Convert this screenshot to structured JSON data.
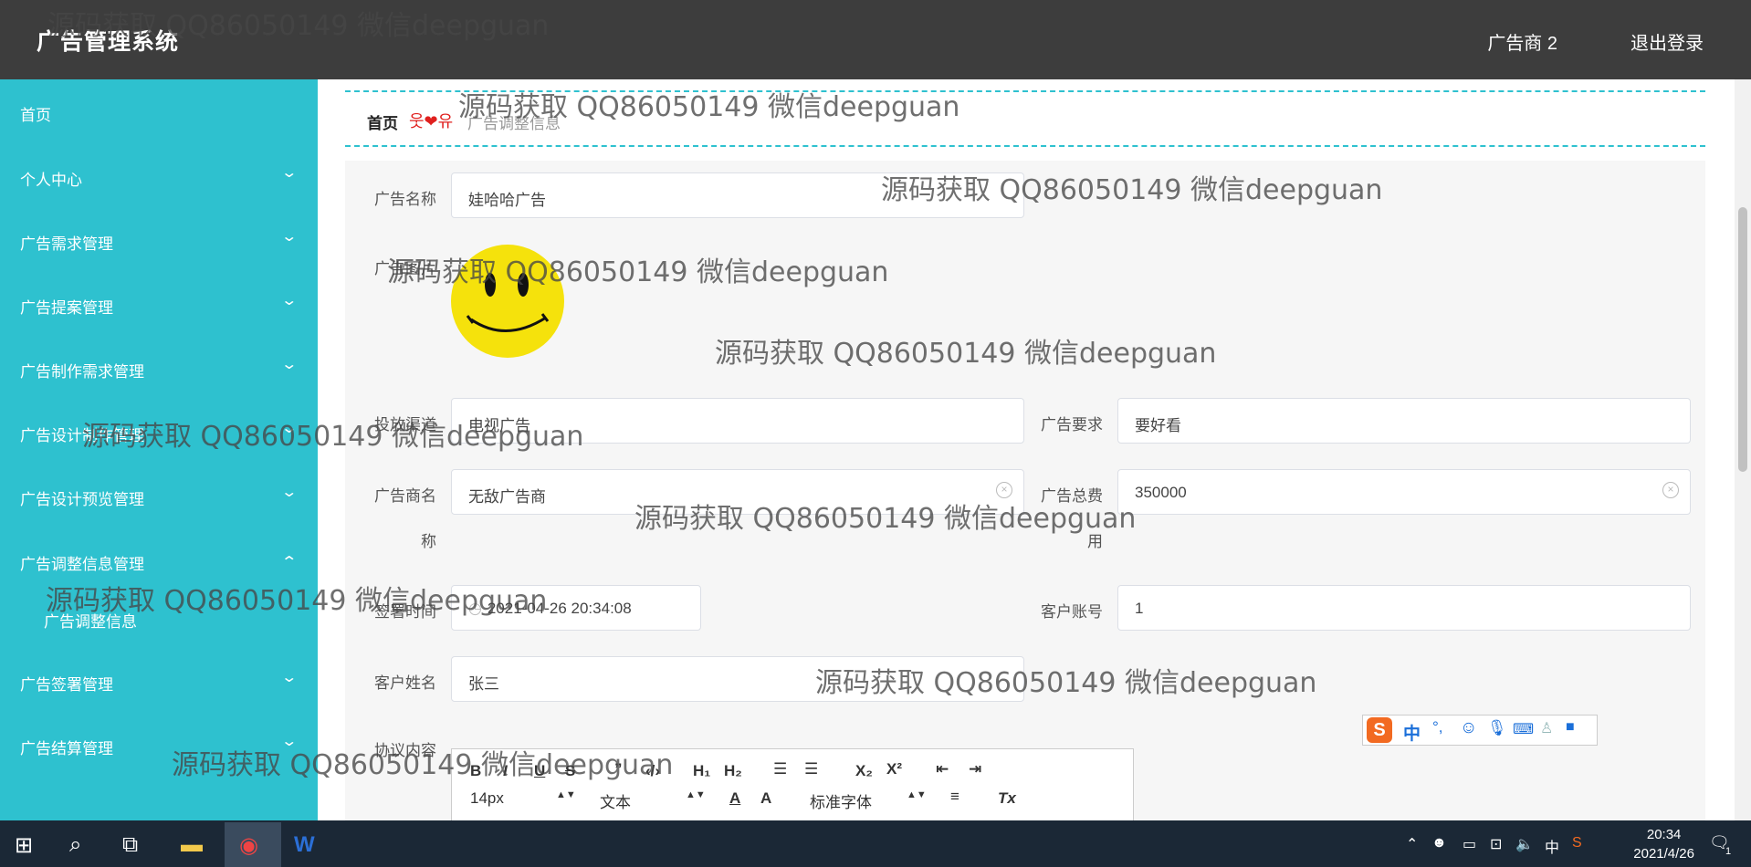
{
  "header": {
    "title": "广告管理系统",
    "user": "广告商 2",
    "logout": "退出登录"
  },
  "sidebar": {
    "items": [
      {
        "label": "首页",
        "chev": ""
      },
      {
        "label": "个人中心",
        "chev": "⌄"
      },
      {
        "label": "广告需求管理",
        "chev": "⌄"
      },
      {
        "label": "广告提案管理",
        "chev": "⌄"
      },
      {
        "label": "广告制作需求管理",
        "chev": "⌄"
      },
      {
        "label": "广告设计制作管理",
        "chev": "⌄"
      },
      {
        "label": "广告设计预览管理",
        "chev": "⌄"
      },
      {
        "label": "广告调整信息管理",
        "chev": "⌃"
      },
      {
        "label": "广告签署管理",
        "chev": "⌄"
      },
      {
        "label": "广告结算管理",
        "chev": "⌄"
      }
    ],
    "sub_item": "广告调整信息"
  },
  "breadcrumb": {
    "home": "首页",
    "separator": "웃❤유",
    "current": "广告调整信息"
  },
  "form": {
    "ad_name_label": "广告名称",
    "ad_name": "娃哈哈广告",
    "ad_image_label": "广告图片",
    "channel_label": "投放渠道",
    "channel": "电视广告",
    "requirement_label": "广告要求",
    "requirement": "要好看",
    "advertiser_label_1": "广告商名",
    "advertiser_label_2": "称",
    "advertiser": "无敌广告商",
    "total_cost_label_1": "广告总费",
    "total_cost_label_2": "用",
    "total_cost": "350000",
    "sign_time_label": "签署时间",
    "sign_time": "2021-04-26 20:34:08",
    "customer_account_label": "客户账号",
    "customer_account": "1",
    "customer_name_label": "客户姓名",
    "customer_name": "张三",
    "agreement_label": "协议内容"
  },
  "editor": {
    "font_size": "14px",
    "paragraph": "文本",
    "font_family": "标准字体"
  },
  "watermark": "源码获取 QQ86050149 微信deepguan",
  "ime": {
    "mode": "中"
  },
  "taskbar": {
    "time": "20:34",
    "date": "2021/4/26",
    "lang": "中",
    "notif": "1"
  }
}
